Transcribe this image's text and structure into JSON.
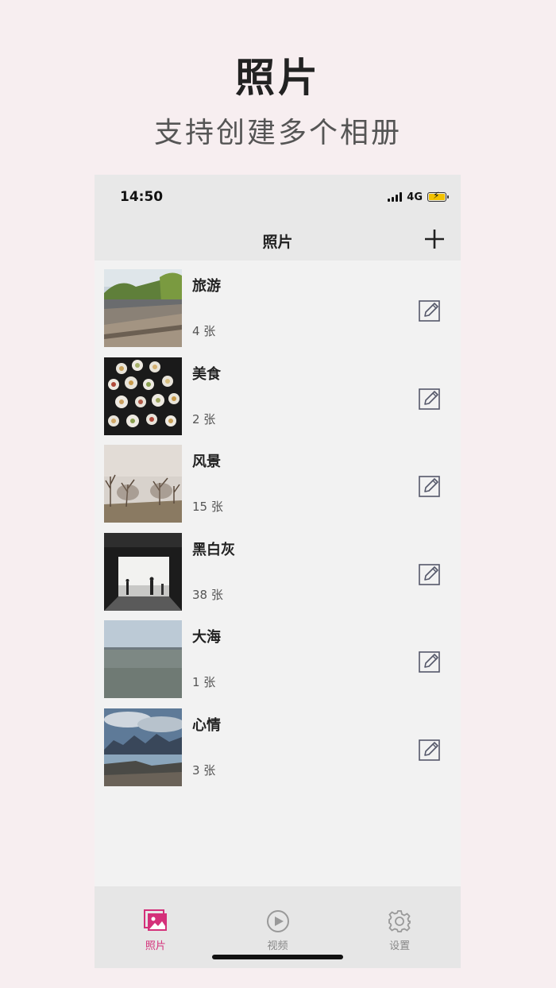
{
  "promo": {
    "title": "照片",
    "subtitle": "支持创建多个相册"
  },
  "status_bar": {
    "time": "14:50",
    "network": "4G",
    "battery_color": "#f2c200"
  },
  "nav": {
    "title": "照片",
    "add_icon": "plus-icon"
  },
  "albums": [
    {
      "name": "旅游",
      "count": "4 张",
      "thumb": "road-scene"
    },
    {
      "name": "美食",
      "count": "2 张",
      "thumb": "food-plates"
    },
    {
      "name": "风景",
      "count": "15 张",
      "thumb": "bare-trees"
    },
    {
      "name": "黑白灰",
      "count": "38 张",
      "thumb": "tunnel-silhouettes"
    },
    {
      "name": "大海",
      "count": "1 张",
      "thumb": "sea-horizon"
    },
    {
      "name": "心情",
      "count": "3 张",
      "thumb": "mountain-lake"
    }
  ],
  "tabs": [
    {
      "label": "照片",
      "icon": "photos-icon",
      "active": true
    },
    {
      "label": "视频",
      "icon": "play-icon",
      "active": false
    },
    {
      "label": "设置",
      "icon": "gear-icon",
      "active": false
    }
  ],
  "colors": {
    "accent": "#d4307a",
    "inactive": "#999999",
    "background": "#f7eef0"
  }
}
